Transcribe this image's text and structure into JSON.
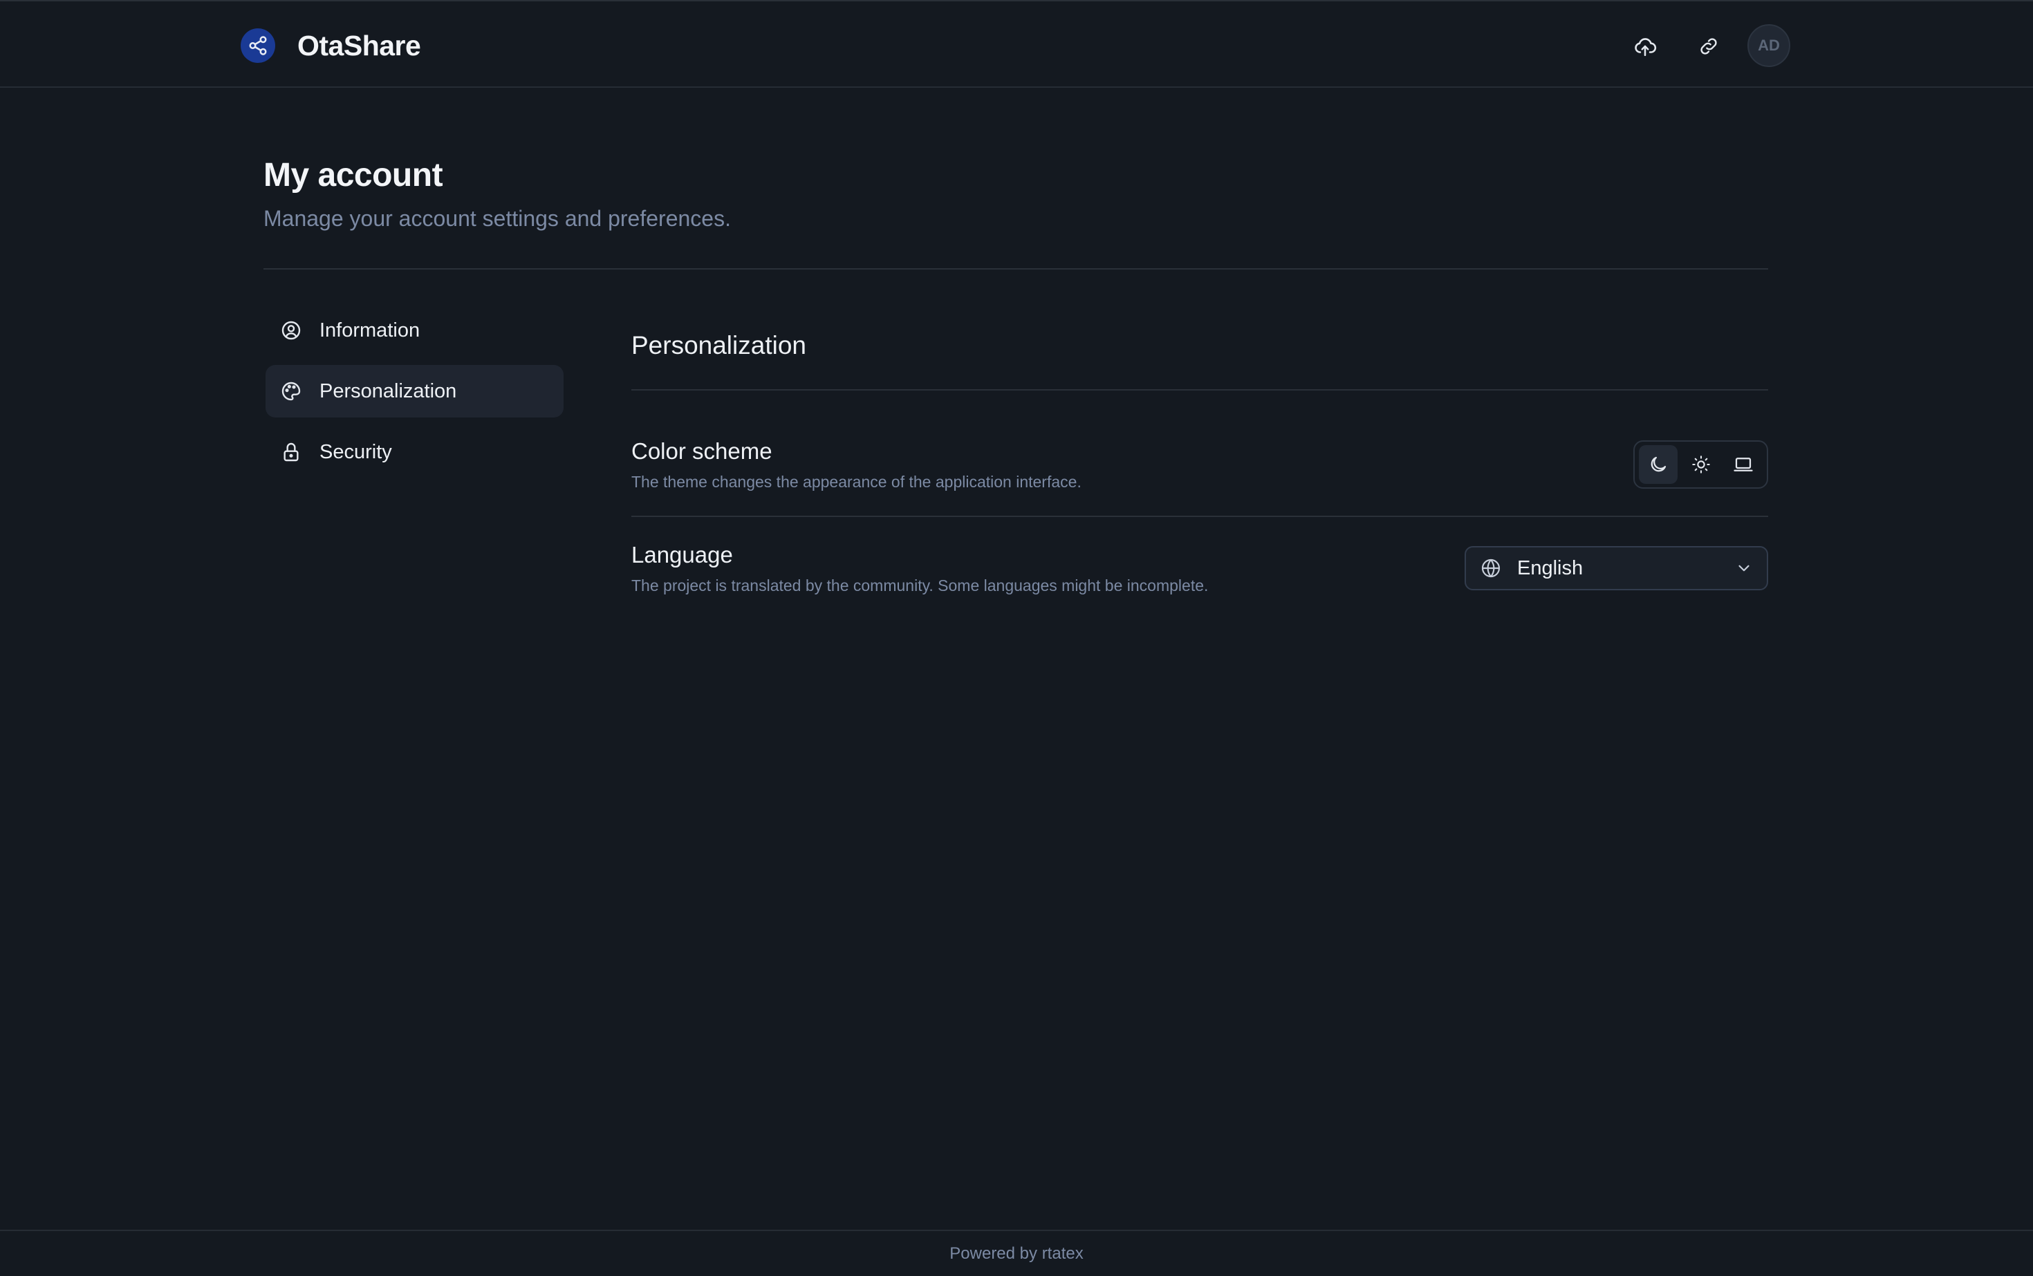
{
  "header": {
    "brand": "OtaShare",
    "avatar_initials": "AD",
    "actions": [
      "upload-icon",
      "link-icon"
    ]
  },
  "page": {
    "title": "My account",
    "subtitle": "Manage your account settings and preferences."
  },
  "sidebar": {
    "items": [
      {
        "label": "Information",
        "icon": "user-circle-icon",
        "active": false
      },
      {
        "label": "Personalization",
        "icon": "palette-icon",
        "active": true
      },
      {
        "label": "Security",
        "icon": "lock-icon",
        "active": false
      }
    ]
  },
  "panel": {
    "title": "Personalization",
    "color_scheme": {
      "title": "Color scheme",
      "description": "The theme changes the appearance of the application interface.",
      "options": [
        "moon-icon",
        "sun-icon",
        "monitor-icon"
      ],
      "selected": "moon-icon"
    },
    "language": {
      "title": "Language",
      "description": "The project is translated by the community. Some languages might be incomplete.",
      "value": "English"
    }
  },
  "footer": {
    "text": "Powered by rtatex"
  },
  "colors": {
    "background": "#141920",
    "logo": "#1a3a95",
    "muted_text": "#7c8aa4"
  }
}
